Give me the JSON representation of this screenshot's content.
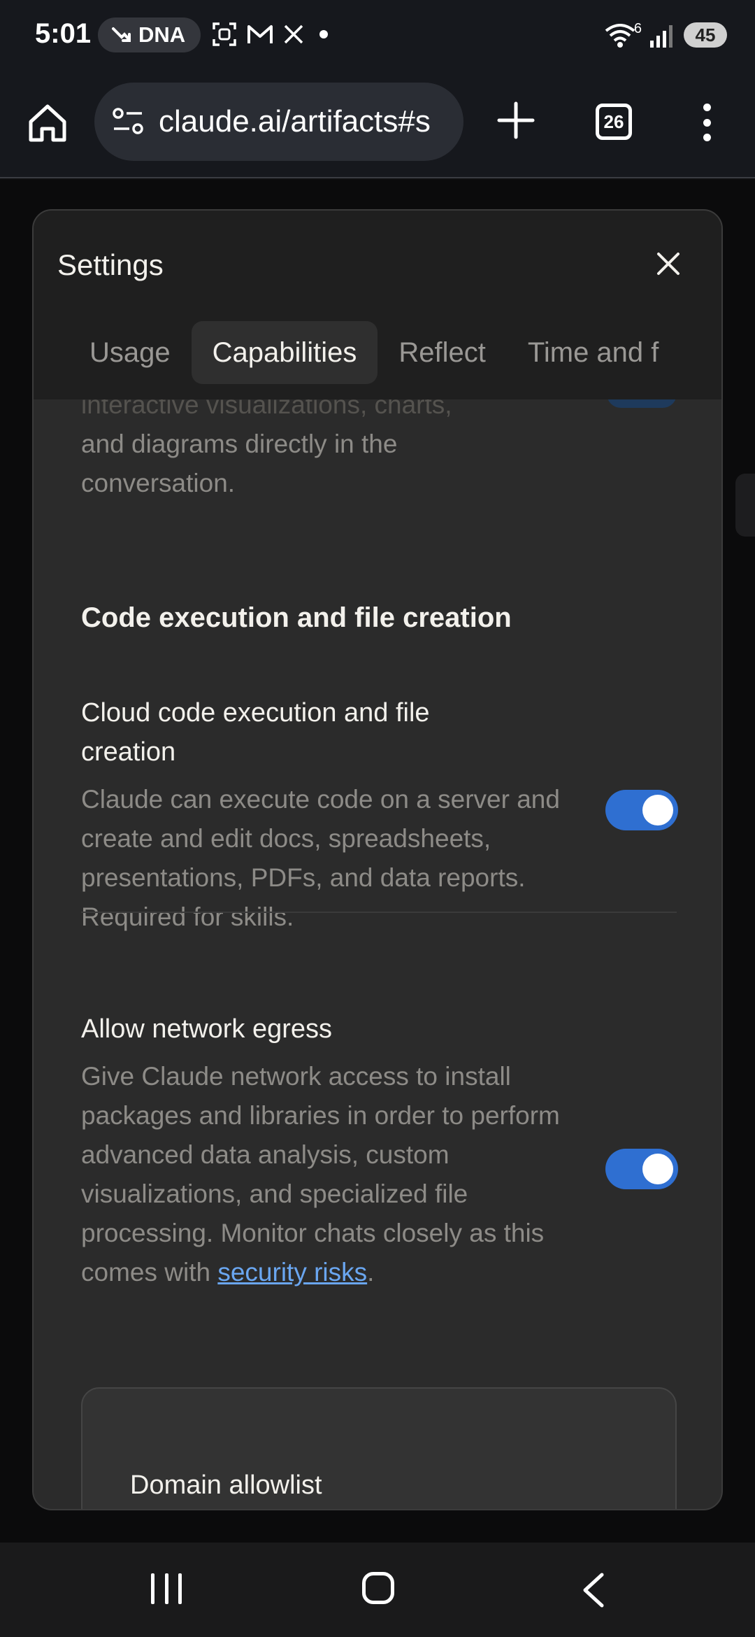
{
  "status_bar": {
    "time": "5:01",
    "pill_text": "DNA",
    "network_sup": "6",
    "battery": "45"
  },
  "browser": {
    "url": "claude.ai/artifacts#s",
    "tab_count": "26"
  },
  "modal": {
    "title": "Settings",
    "tabs": [
      {
        "label": "Usage"
      },
      {
        "label": "Capabilities"
      },
      {
        "label": "Reflect"
      },
      {
        "label": "Time and f"
      }
    ],
    "active_tab": "Capabilities"
  },
  "content": {
    "prev_desc_cut": "interactive visualizations, charts,",
    "prev_desc_line2": "and diagrams directly in the",
    "prev_desc_line3": "conversation.",
    "section_title": "Code execution and file creation",
    "settings": [
      {
        "label": "Cloud code execution and file creation",
        "desc": "Claude can execute code on a server and create and edit docs, spreadsheets, presentations, PDFs, and data reports. Required for skills.",
        "enabled": true
      },
      {
        "label": "Allow network egress",
        "desc": "Give Claude network access to install packages and libraries in order to perform advanced data analysis, custom visualizations, and specialized file processing. Monitor chats closely as this comes with",
        "link_text": "security risks",
        "desc_end": ".",
        "enabled": true
      }
    ],
    "domain_card_title": "Domain allowlist"
  },
  "colors": {
    "accent": "#2f6fd1",
    "link": "#6aa6f0"
  }
}
